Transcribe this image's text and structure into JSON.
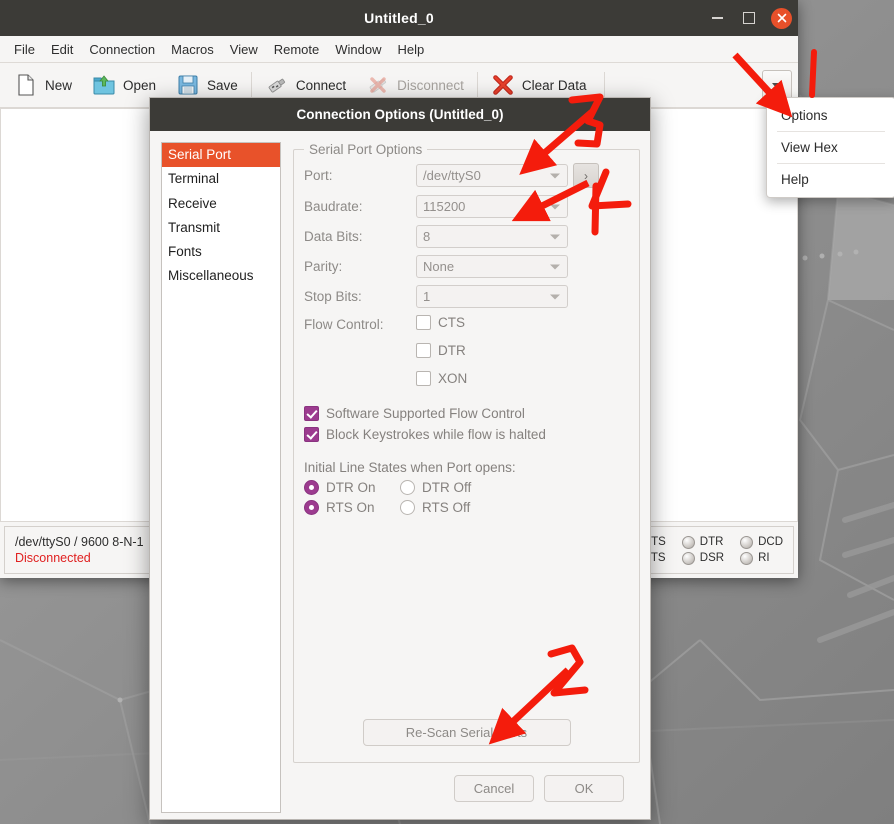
{
  "window": {
    "title": "Untitled_0",
    "controls": {
      "minimize": "–",
      "maximize": "□",
      "close": "✕"
    }
  },
  "menubar": {
    "items": [
      "File",
      "Edit",
      "Connection",
      "Macros",
      "View",
      "Remote",
      "Window",
      "Help"
    ]
  },
  "toolbar": {
    "items": [
      {
        "label": "New",
        "icon": "new-document-icon",
        "disabled": false
      },
      {
        "label": "Open",
        "icon": "open-folder-icon",
        "disabled": false
      },
      {
        "label": "Save",
        "icon": "floppy-disk-icon",
        "disabled": false
      },
      {
        "label": "Connect",
        "icon": "usb-plug-icon",
        "disabled": false
      },
      {
        "label": "Disconnect",
        "icon": "usb-plug-disabled-icon",
        "disabled": true
      },
      {
        "label": "Clear Data",
        "icon": "red-x-icon",
        "disabled": false
      }
    ],
    "overflow_caret": "▾"
  },
  "toolbar_menu": {
    "items": [
      "Options",
      "View Hex",
      "Help"
    ]
  },
  "statusbar": {
    "port_summary": "/dev/ttyS0 / 9600 8-N-1",
    "connection_state": "Disconnected",
    "connection_state_color": "#e02020",
    "leds": [
      "CTS",
      "DTR",
      "DCD",
      "RTS",
      "DSR",
      "RI"
    ]
  },
  "dialog": {
    "title": "Connection Options (Untitled_0)",
    "sidebar": {
      "items": [
        "Serial Port",
        "Terminal",
        "Receive",
        "Transmit",
        "Fonts",
        "Miscellaneous"
      ],
      "selected_index": 0,
      "selected_color": "#e8522a"
    },
    "group_title": "Serial Port Options",
    "fields": [
      {
        "label": "Port:",
        "value": "/dev/ttyS0"
      },
      {
        "label": "Baudrate:",
        "value": "115200"
      },
      {
        "label": "Data Bits:",
        "value": "8"
      },
      {
        "label": "Parity:",
        "value": "None"
      },
      {
        "label": "Stop Bits:",
        "value": "1"
      }
    ],
    "port_browse_button": "›",
    "flow_control": {
      "label": "Flow Control:",
      "options": [
        {
          "label": "CTS",
          "checked": false
        },
        {
          "label": "DTR",
          "checked": false
        },
        {
          "label": "XON",
          "checked": false
        }
      ]
    },
    "extra_checkboxes": [
      {
        "label": "Software Supported Flow Control",
        "checked": true
      },
      {
        "label": "Block Keystrokes while flow is halted",
        "checked": true
      }
    ],
    "initial_line_states": {
      "title": "Initial Line States when Port opens:",
      "rows": [
        {
          "on_label": "DTR On",
          "on_selected": true,
          "off_label": "DTR Off",
          "off_selected": false
        },
        {
          "on_label": "RTS On",
          "on_selected": true,
          "off_label": "RTS Off",
          "off_selected": false
        }
      ]
    },
    "rescan_button": "Re-Scan Serial Ports",
    "cancel_button": "Cancel",
    "ok_button": "OK",
    "checkbox_accent": "#9c3b8f"
  },
  "annotations": {
    "color": "#f41c0c",
    "marks": [
      "1",
      "2",
      "3",
      "4"
    ]
  }
}
